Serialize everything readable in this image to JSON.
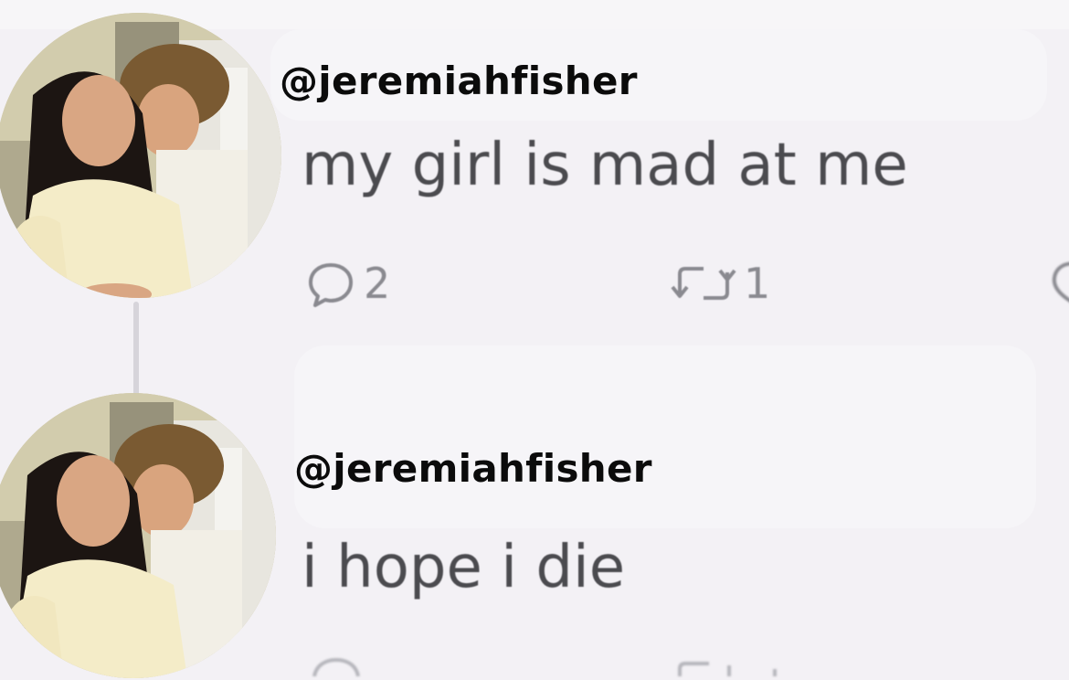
{
  "posts": [
    {
      "handle": "@jeremiahfisher",
      "text": "my girl is mad at me",
      "reply_count": "2",
      "repost_count": "1",
      "avatar": "profile-photo"
    },
    {
      "handle": "@jeremiahfisher",
      "text": "i hope i die",
      "avatar": "profile-photo"
    }
  ],
  "icons": {
    "reply": "speech-bubble-icon",
    "repost": "repost-arrows-icon",
    "like": "heart-icon",
    "threads": "threads-logo-icon"
  },
  "colors": {
    "handle": "#0b0b0b",
    "text": "#4b4b4f",
    "icons": "#8a8a90",
    "background": "#f3f1f5"
  }
}
